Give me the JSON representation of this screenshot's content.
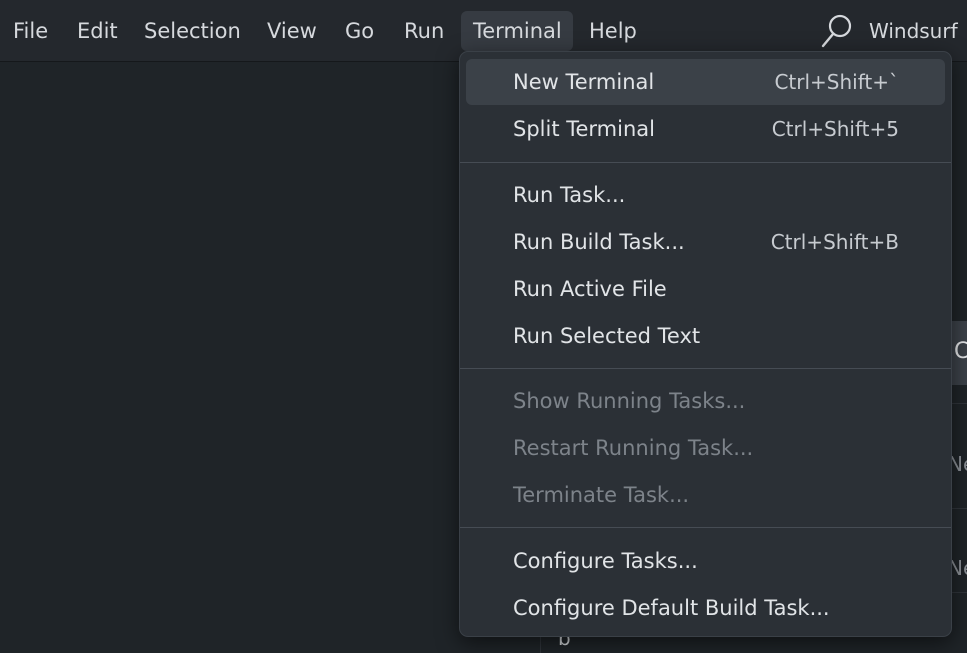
{
  "menubar": {
    "items": [
      {
        "label": "File"
      },
      {
        "label": "Edit"
      },
      {
        "label": "Selection"
      },
      {
        "label": "View"
      },
      {
        "label": "Go"
      },
      {
        "label": "Run"
      },
      {
        "label": "Terminal",
        "active": true
      },
      {
        "label": "Help"
      }
    ],
    "app_title": "Windsurf",
    "search_icon": "search-icon"
  },
  "terminal_menu": {
    "groups": [
      [
        {
          "label": "New Terminal",
          "shortcut": "Ctrl+Shift+`",
          "highlighted": true
        },
        {
          "label": "Split Terminal",
          "shortcut": "Ctrl+Shift+5"
        }
      ],
      [
        {
          "label": "Run Task..."
        },
        {
          "label": "Run Build Task...",
          "shortcut": "Ctrl+Shift+B"
        },
        {
          "label": "Run Active File"
        },
        {
          "label": "Run Selected Text"
        }
      ],
      [
        {
          "label": "Show Running Tasks...",
          "disabled": true
        },
        {
          "label": "Restart Running Task...",
          "disabled": true
        },
        {
          "label": "Terminate Task...",
          "disabled": true
        }
      ],
      [
        {
          "label": "Configure Tasks..."
        },
        {
          "label": "Configure Default Build Task..."
        }
      ]
    ]
  },
  "background": {
    "side_block_letter": "C",
    "side_text_1": "Ne",
    "side_text_2": "Ne",
    "stub_letter": "b"
  },
  "colors": {
    "menubar_bg": "#24282d",
    "editor_bg": "#1f2428",
    "menu_bg": "#2b3036",
    "menu_highlight": "#3b4148",
    "text": "#e1e4e7",
    "disabled_text": "#7d838a"
  }
}
